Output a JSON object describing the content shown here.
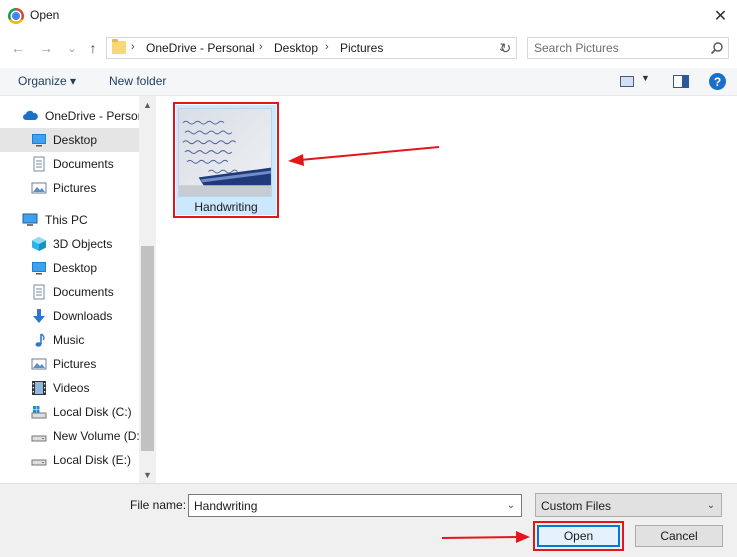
{
  "window": {
    "title": "Open",
    "close_symbol": "✕"
  },
  "nav_buttons": {
    "back_symbol": "←",
    "forward_symbol": "→",
    "recent_symbol": "⌄",
    "up_symbol": "↑"
  },
  "breadcrumb": {
    "items": [
      "OneDrive - Personal",
      "Desktop",
      "Pictures"
    ],
    "separator": "›",
    "dropdown_symbol": "⌄",
    "refresh_symbol": "↻"
  },
  "search": {
    "placeholder": "Search Pictures"
  },
  "toolbar": {
    "organize_label": "Organize ▾",
    "new_folder_label": "New folder",
    "view_dropdown_symbol": "▼",
    "help_symbol": "?"
  },
  "nav_pane": {
    "items": [
      {
        "label": "OneDrive - Personal",
        "icon": "cloud-icon"
      },
      {
        "label": "Desktop",
        "icon": "desktop-icon"
      },
      {
        "label": "Documents",
        "icon": "documents-icon"
      },
      {
        "label": "Pictures",
        "icon": "pictures-icon"
      },
      {
        "label": "This PC",
        "icon": "computer-icon"
      },
      {
        "label": "3D Objects",
        "icon": "cube-icon"
      },
      {
        "label": "Desktop",
        "icon": "desktop-icon"
      },
      {
        "label": "Documents",
        "icon": "documents-icon"
      },
      {
        "label": "Downloads",
        "icon": "download-icon"
      },
      {
        "label": "Music",
        "icon": "music-icon"
      },
      {
        "label": "Pictures",
        "icon": "pictures-icon"
      },
      {
        "label": "Videos",
        "icon": "video-icon"
      },
      {
        "label": "Local Disk (C:)",
        "icon": "windows-drive-icon"
      },
      {
        "label": "New Volume (D:)",
        "icon": "drive-icon"
      },
      {
        "label": "Local Disk (E:)",
        "icon": "drive-icon"
      }
    ],
    "scroll_up_symbol": "▲",
    "scroll_down_symbol": "▼"
  },
  "files": [
    {
      "name": "Handwriting",
      "thumbnail": "handwriting-image",
      "selected": true
    }
  ],
  "bottom": {
    "file_name_label": "File name:",
    "file_name_value": "Handwriting",
    "file_type_value": "Custom Files",
    "dropdown_symbol": "⌄",
    "open_label": "Open",
    "cancel_label": "Cancel"
  },
  "colors": {
    "annotation_red": "#e3171b",
    "selection_blue": "#cce8ff",
    "accent": "#0078d7"
  }
}
